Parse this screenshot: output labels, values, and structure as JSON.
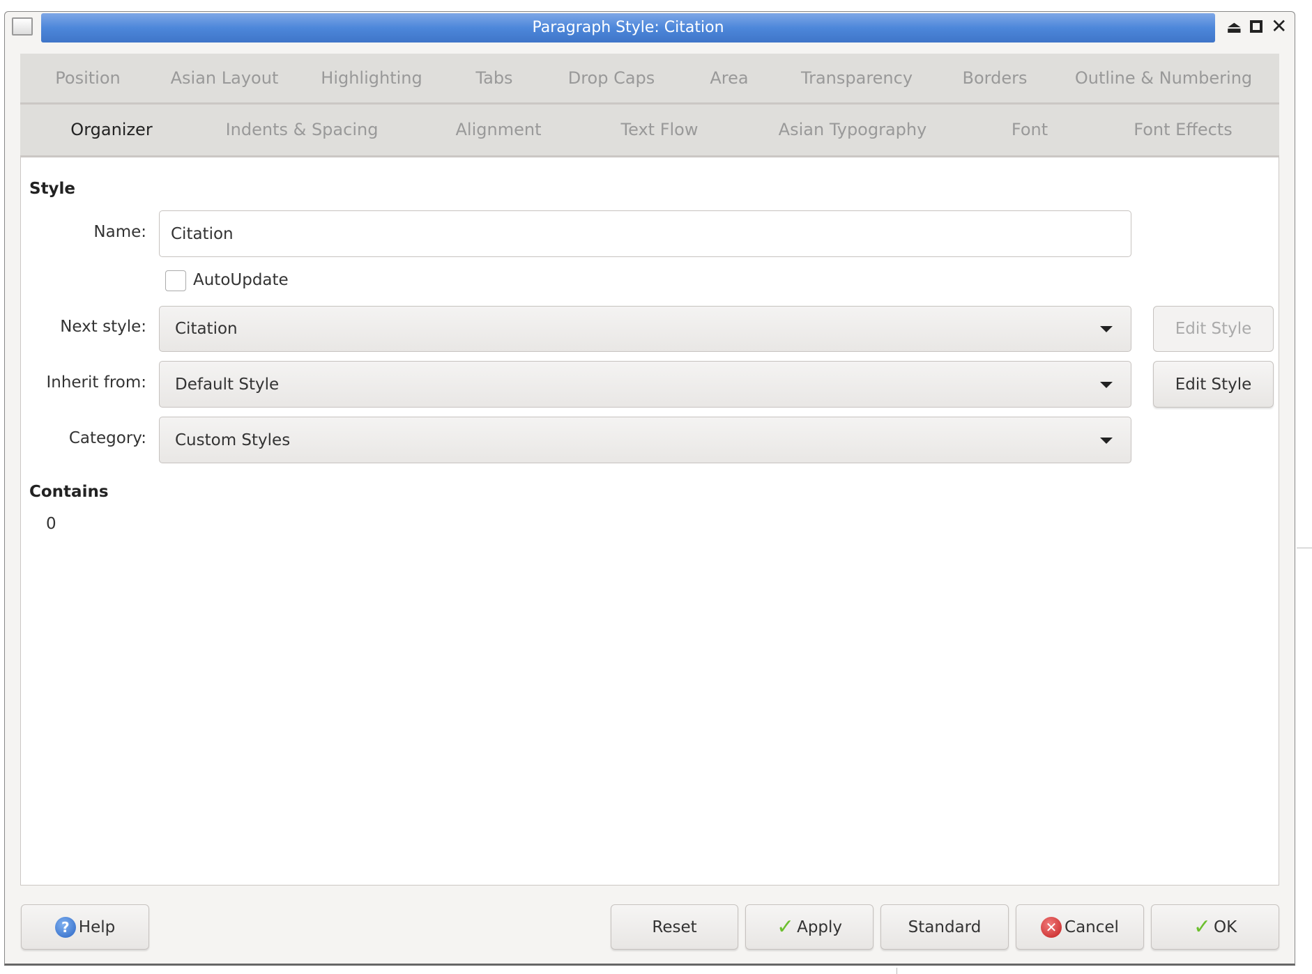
{
  "window": {
    "title": "Paragraph Style: Citation",
    "controls": [
      "eject-icon",
      "maximize-icon",
      "close-icon"
    ]
  },
  "tabs": {
    "row1": [
      "Position",
      "Asian Layout",
      "Highlighting",
      "Tabs",
      "Drop Caps",
      "Area",
      "Transparency",
      "Borders",
      "Outline & Numbering"
    ],
    "row2": [
      "Organizer",
      "Indents & Spacing",
      "Alignment",
      "Text Flow",
      "Asian Typography",
      "Font",
      "Font Effects"
    ],
    "active": "Organizer"
  },
  "style": {
    "heading": "Style",
    "name_label": "Name:",
    "name_value": "Citation",
    "autoupdate_label": "AutoUpdate",
    "autoupdate_checked": false,
    "next_label": "Next style:",
    "next_value": "Citation",
    "inherit_label": "Inherit from:",
    "inherit_value": "Default Style",
    "category_label": "Category:",
    "category_value": "Custom Styles",
    "edit_style_1": "Edit Style",
    "edit_style_2": "Edit Style"
  },
  "contains": {
    "heading": "Contains",
    "value": "0"
  },
  "buttons": {
    "help": "Help",
    "reset": "Reset",
    "apply": "Apply",
    "standard": "Standard",
    "cancel": "Cancel",
    "ok": "OK"
  },
  "colors": {
    "titlebar": "#4d87da",
    "accent": "#4a7fd4"
  }
}
